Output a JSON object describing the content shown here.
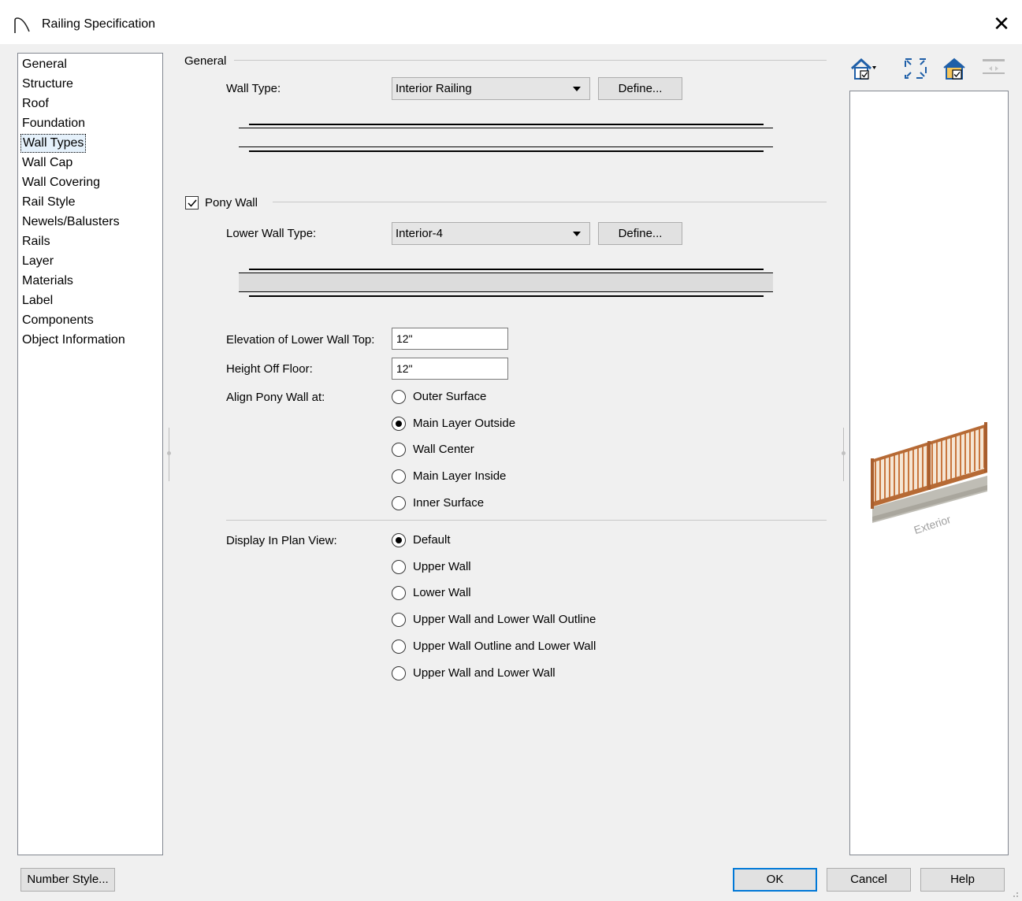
{
  "window": {
    "title": "Railing Specification",
    "close_label": "✕"
  },
  "sidebar": {
    "items": [
      {
        "label": "General"
      },
      {
        "label": "Structure"
      },
      {
        "label": "Roof"
      },
      {
        "label": "Foundation"
      },
      {
        "label": "Wall Types",
        "selected": true
      },
      {
        "label": "Wall Cap"
      },
      {
        "label": "Wall Covering"
      },
      {
        "label": "Rail Style"
      },
      {
        "label": "Newels/Balusters"
      },
      {
        "label": "Rails"
      },
      {
        "label": "Layer"
      },
      {
        "label": "Materials"
      },
      {
        "label": "Label"
      },
      {
        "label": "Components"
      },
      {
        "label": "Object Information"
      }
    ]
  },
  "general": {
    "group_label": "General",
    "wall_type_label": "Wall Type:",
    "wall_type_value": "Interior Railing",
    "define_label": "Define..."
  },
  "pony": {
    "checkbox_label": "Pony Wall",
    "checked": true,
    "lower_wall_type_label": "Lower Wall Type:",
    "lower_wall_type_value": "Interior-4",
    "define_label": "Define...",
    "elevation_label": "Elevation of Lower Wall Top:",
    "elevation_value": "12\"",
    "height_label": "Height Off Floor:",
    "height_value": "12\"",
    "align_label": "Align Pony Wall at:",
    "align_options": [
      "Outer Surface",
      "Main Layer Outside",
      "Wall Center",
      "Main Layer Inside",
      "Inner Surface"
    ],
    "align_selected": "Main Layer Outside"
  },
  "display": {
    "label": "Display In Plan View:",
    "options": [
      "Default",
      "Upper Wall",
      "Lower Wall",
      "Upper Wall and Lower Wall Outline",
      "Upper Wall Outline and Lower Wall",
      "Upper Wall and Lower Wall"
    ],
    "selected": "Default"
  },
  "preview": {
    "caption": "Exterior"
  },
  "footer": {
    "number_style_label": "Number Style...",
    "ok_label": "OK",
    "cancel_label": "Cancel",
    "help_label": "Help"
  },
  "icons": [
    "railing-title-icon",
    "house-view-icon",
    "fill-window-icon",
    "house-check-icon",
    "swap-icon"
  ]
}
